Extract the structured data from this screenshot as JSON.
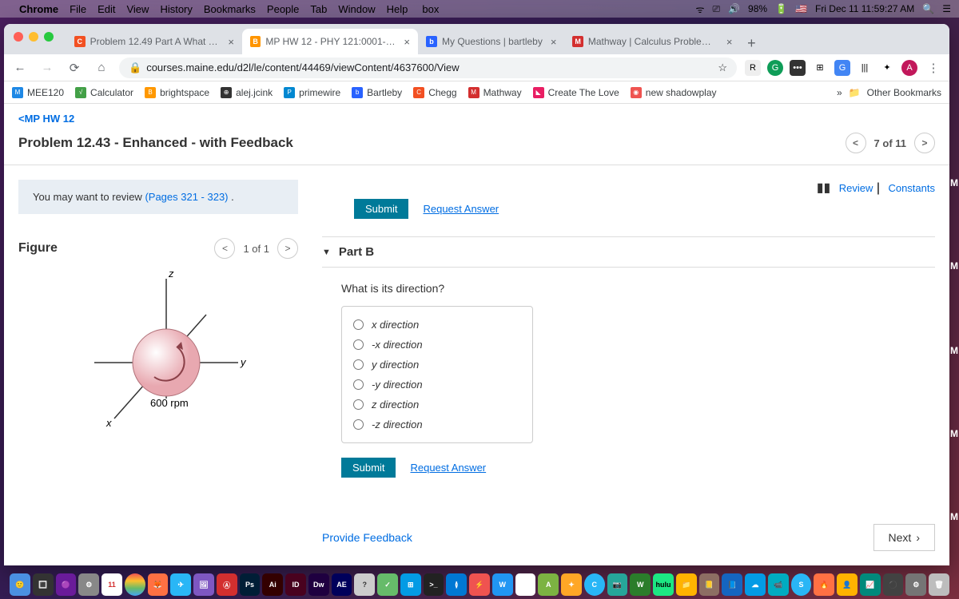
{
  "menubar": {
    "app": "Chrome",
    "items": [
      "File",
      "Edit",
      "View",
      "History",
      "Bookmarks",
      "People",
      "Tab",
      "Window",
      "Help"
    ],
    "battery": "98%",
    "datetime": "Fri Dec 11  11:59:27 AM"
  },
  "tabs": [
    {
      "label": "Problem 12.49 Part A What Is T",
      "favbg": "#f25022",
      "favtxt": "C"
    },
    {
      "label": "MP HW 12 - PHY 121:0001-Phy",
      "favbg": "#ff9500",
      "favtxt": "B",
      "active": true
    },
    {
      "label": "My Questions | bartleby",
      "favbg": "#2962ff",
      "favtxt": "b"
    },
    {
      "label": "Mathway | Calculus Problem So",
      "favbg": "#d32f2f",
      "favtxt": "M"
    }
  ],
  "newtab": "+",
  "url": "courses.maine.edu/d2l/le/content/44469/viewContent/4637600/View",
  "bookmarks": [
    {
      "label": "MEE120",
      "bg": "#1e88e5",
      "txt": "M"
    },
    {
      "label": "Calculator",
      "bg": "#43a047",
      "txt": "√"
    },
    {
      "label": "brightspace",
      "bg": "#ff9800",
      "txt": "B"
    },
    {
      "label": "alej.jcink",
      "bg": "#333",
      "txt": "⊕"
    },
    {
      "label": "primewire",
      "bg": "#0288d1",
      "txt": "P"
    },
    {
      "label": "Bartleby",
      "bg": "#2962ff",
      "txt": "b"
    },
    {
      "label": "Chegg",
      "bg": "#f25022",
      "txt": "C"
    },
    {
      "label": "Mathway",
      "bg": "#d32f2f",
      "txt": "M"
    },
    {
      "label": "Create The Love",
      "bg": "#e91e63",
      "txt": "◣"
    },
    {
      "label": "new shadowplay",
      "bg": "#ef5350",
      "txt": "◉"
    }
  ],
  "bm_overflow": "»",
  "bm_other": "Other Bookmarks",
  "breadcrumb": "MP HW 12",
  "problem_title": "Problem 12.43 - Enhanced - with Feedback",
  "pager": "7 of 11",
  "review_text": "You may want to review ",
  "review_link": "(Pages 321 - 323)",
  "review_dot": " .",
  "right_links": {
    "review": "Review",
    "sep": " | ",
    "constants": "Constants"
  },
  "submit": "Submit",
  "request_answer": "Request Answer",
  "figure": {
    "title": "Figure",
    "pager": "1 of 1",
    "rpm": "600 rpm",
    "x": "x",
    "y": "y",
    "z": "z"
  },
  "partB": {
    "title": "Part B",
    "question": "What is its direction?",
    "options": [
      "x direction",
      "-x direction",
      "y direction",
      "-y direction",
      "z direction",
      "-z direction"
    ]
  },
  "provide_feedback": "Provide Feedback",
  "next": "Next"
}
